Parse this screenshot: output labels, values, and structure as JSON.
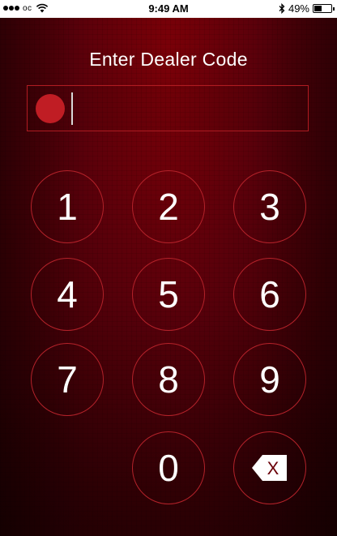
{
  "status_bar": {
    "carrier": "oc",
    "time": "9:49 AM",
    "battery_percent": "49%",
    "battery_level": 0.49,
    "signal_bars_filled": 3,
    "signal_bars_total": 5,
    "icons": [
      "signal-dots-icon",
      "wifi-icon",
      "bluetooth-icon",
      "battery-icon"
    ]
  },
  "header": {
    "title": "Enter Dealer Code"
  },
  "code_entry": {
    "value": "",
    "indicator_icon": "red-dot-icon"
  },
  "keypad": {
    "keys": [
      "1",
      "2",
      "3",
      "4",
      "5",
      "6",
      "7",
      "8",
      "9",
      "0"
    ],
    "backspace_label": "X",
    "backspace_icon": "backspace-icon"
  },
  "colors": {
    "background": "#58000a",
    "accent": "#b4222a",
    "indicator": "#c01d24",
    "text": "#ffffff"
  }
}
